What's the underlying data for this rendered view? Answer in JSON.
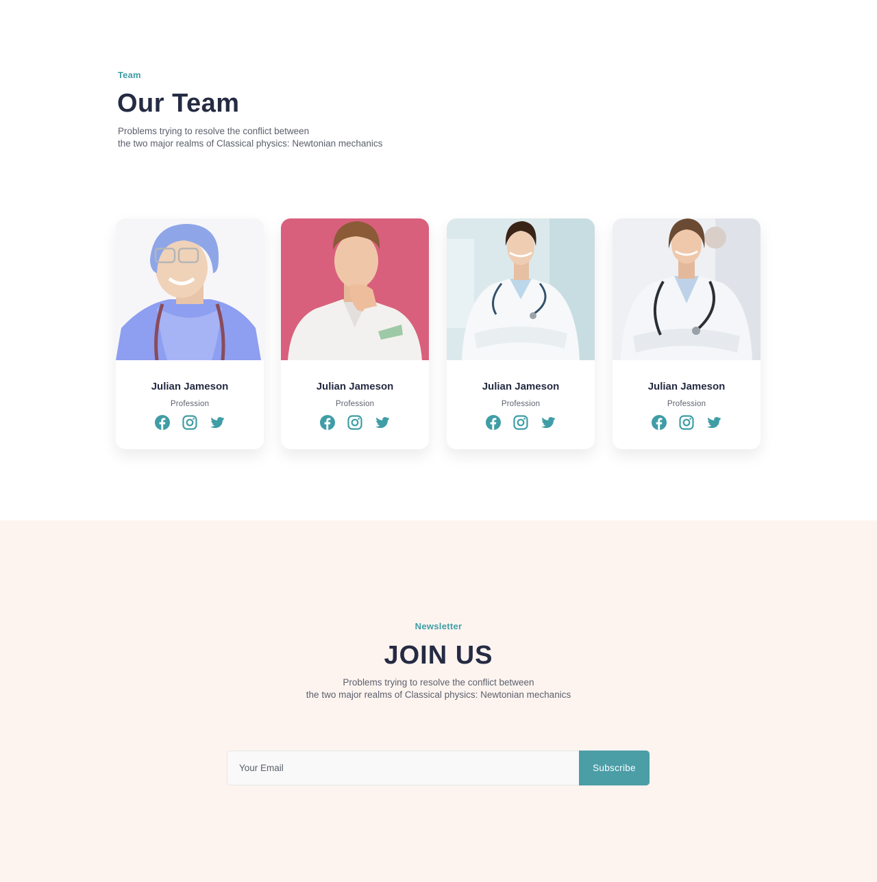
{
  "team": {
    "eyebrow": "Team",
    "title": "Our Team",
    "description_lines": [
      "Problems trying to resolve the conflict between",
      "the two major realms of Classical physics: Newtonian mechanics"
    ],
    "members": [
      {
        "name": "Julian Jameson",
        "profession": "Profession",
        "photo": "surgeon-in-scrub-cap-photo",
        "socials": [
          "facebook-icon",
          "instagram-icon",
          "twitter-icon"
        ]
      },
      {
        "name": "Julian Jameson",
        "profession": "Profession",
        "photo": "man-in-white-blazer-photo",
        "socials": [
          "facebook-icon",
          "instagram-icon",
          "twitter-icon"
        ]
      },
      {
        "name": "Julian Jameson",
        "profession": "Profession",
        "photo": "female-doctor-stethoscope-photo",
        "socials": [
          "facebook-icon",
          "instagram-icon",
          "twitter-icon"
        ]
      },
      {
        "name": "Julian Jameson",
        "profession": "Profession",
        "photo": "female-doctor-arms-crossed-photo",
        "socials": [
          "facebook-icon",
          "instagram-icon",
          "twitter-icon"
        ]
      }
    ]
  },
  "newsletter": {
    "eyebrow": "Newsletter",
    "title": "JOIN US",
    "description_lines": [
      "Problems trying to resolve the conflict between",
      "the two major realms of Classical physics: Newtonian mechanics"
    ],
    "email_placeholder": "Your Email",
    "email_value": "",
    "subscribe_label": "Subscribe"
  },
  "colors": {
    "accent": "#3F9DA6",
    "heading": "#252B42",
    "muted": "#5b5f6b",
    "newsletter_bg": "#FDF4F0",
    "button_bg": "#4B9DA6"
  }
}
